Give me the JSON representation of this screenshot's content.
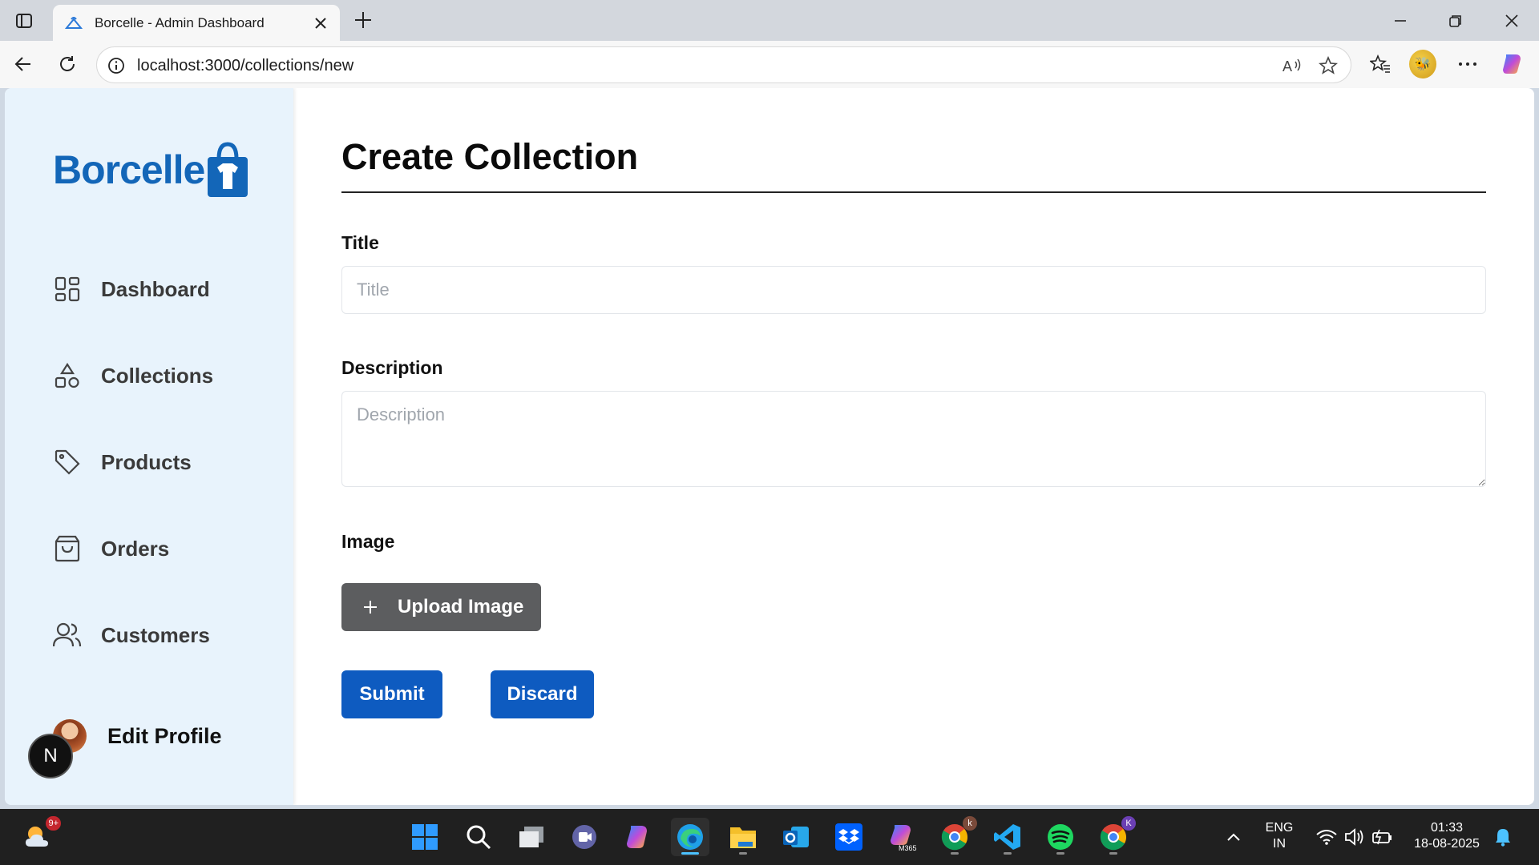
{
  "browser": {
    "tab_title": "Borcelle - Admin Dashboard",
    "url": "localhost:3000/collections/new"
  },
  "sidebar": {
    "logo_text": "Borcelle",
    "items": [
      {
        "label": "Dashboard",
        "icon": "dashboard-icon"
      },
      {
        "label": "Collections",
        "icon": "shapes-icon"
      },
      {
        "label": "Products",
        "icon": "tag-icon"
      },
      {
        "label": "Orders",
        "icon": "shopping-bag-icon"
      },
      {
        "label": "Customers",
        "icon": "users-icon"
      }
    ],
    "profile_label": "Edit Profile",
    "user_initial": "N"
  },
  "form": {
    "heading": "Create Collection",
    "title_label": "Title",
    "title_placeholder": "Title",
    "title_value": "",
    "description_label": "Description",
    "description_placeholder": "Description",
    "description_value": "",
    "image_label": "Image",
    "upload_label": "Upload Image",
    "submit_label": "Submit",
    "discard_label": "Discard"
  },
  "colors": {
    "brand": "#1366b8",
    "primary_button": "#0e5bc0",
    "upload_button": "#5c5d5f",
    "sidebar_bg": "#e8f3fc"
  },
  "taskbar": {
    "weather_badge": "9+",
    "apps": [
      "start-icon",
      "search-icon",
      "task-view-icon",
      "teams-icon",
      "copilot-icon",
      "edge-icon",
      "file-explorer-icon",
      "outlook-icon",
      "dropbox-icon",
      "m365-icon",
      "chrome-icon",
      "vscode-icon",
      "spotify-icon",
      "chrome-icon"
    ],
    "m365_label": "M365",
    "chrome_badge_1": "k",
    "chrome_badge_2": "K",
    "lang_line1": "ENG",
    "lang_line2": "IN",
    "time": "01:33",
    "date": "18-08-2025"
  }
}
